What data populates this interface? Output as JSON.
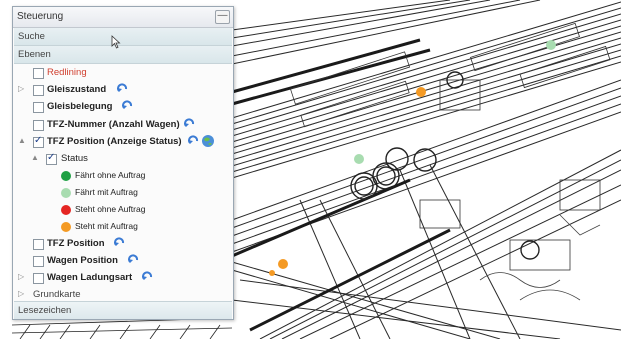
{
  "panel": {
    "title": "Steuerung",
    "minimize_glyph": "—",
    "search_label": "Suche",
    "layers_label": "Ebenen",
    "bookmarks_label": "Lesezeichen",
    "collapse_glyph": "▲",
    "expand_glyph": "▷"
  },
  "layers": {
    "redlining": "Redlining",
    "gleiszustand": "Gleiszustand",
    "gleisbelegung": "Gleisbelegung",
    "tfz_nummer": "TFZ-Nummer (Anzahl Wagen)",
    "tfz_position_status": "TFZ Position (Anzeige Status)",
    "status": "Status",
    "legend": [
      {
        "label": "Fährt ohne Auftrag",
        "color": "#1ea043"
      },
      {
        "label": "Fährt mit Auftrag",
        "color": "#a8dcb0"
      },
      {
        "label": "Steht ohne Auftrag",
        "color": "#e52623"
      },
      {
        "label": "Steht mit Auftrag",
        "color": "#f49a24"
      }
    ],
    "tfz_position": "TFZ Position",
    "wagen_position": "Wagen Position",
    "wagen_ladungsart": "Wagen Ladungsart",
    "grundkarte": "Grundkarte"
  },
  "colors": {
    "refresh_icon": "#3b7bd4",
    "map_line": "#2a2a2a",
    "marker_green": "#a8dcb0",
    "marker_orange": "#f49a24"
  },
  "icons": [
    "refresh-icon",
    "globe-icon",
    "cursor-icon",
    "chevron-right-icon",
    "chevron-down-icon",
    "minimize-icon"
  ]
}
